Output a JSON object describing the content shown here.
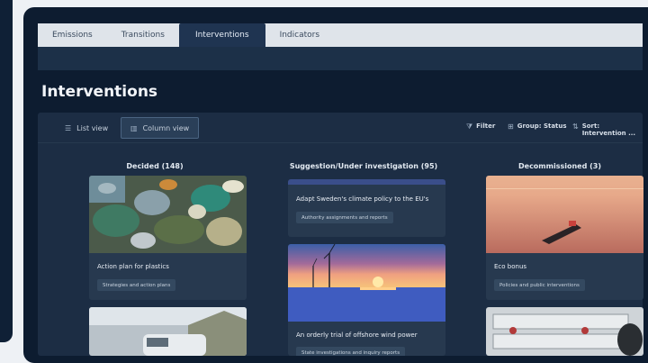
{
  "tabs": [
    {
      "label": "Emissions"
    },
    {
      "label": "Transitions"
    },
    {
      "label": "Interventions"
    },
    {
      "label": "Indicators"
    }
  ],
  "page_title": "Interventions",
  "toolbar": {
    "list_view": "List view",
    "column_view": "Column view",
    "filter": "Filter",
    "group": "Group: Status",
    "sort": "Sort: Intervention ..."
  },
  "columns": [
    {
      "header": "Decided (148)",
      "cards": [
        {
          "title": "Action plan for plastics",
          "tag": "Strategies and action plans"
        }
      ]
    },
    {
      "header": "Suggestion/Under investigation (95)",
      "cards": [
        {
          "title": "Adapt Sweden's climate policy to the EU's",
          "tag": "Authority assignments and reports"
        },
        {
          "title": "An orderly trial of offshore wind power",
          "tag": "State investigations and inquiry reports"
        }
      ]
    },
    {
      "header": "Decommissioned (3)",
      "cards": [
        {
          "title": "Eco bonus",
          "tag": "Policies and public interventions"
        }
      ]
    }
  ],
  "colors": {
    "background": "#0d1c30",
    "panel": "#1c2d44",
    "card": "#27394f",
    "active_tab": "#1f3451"
  }
}
